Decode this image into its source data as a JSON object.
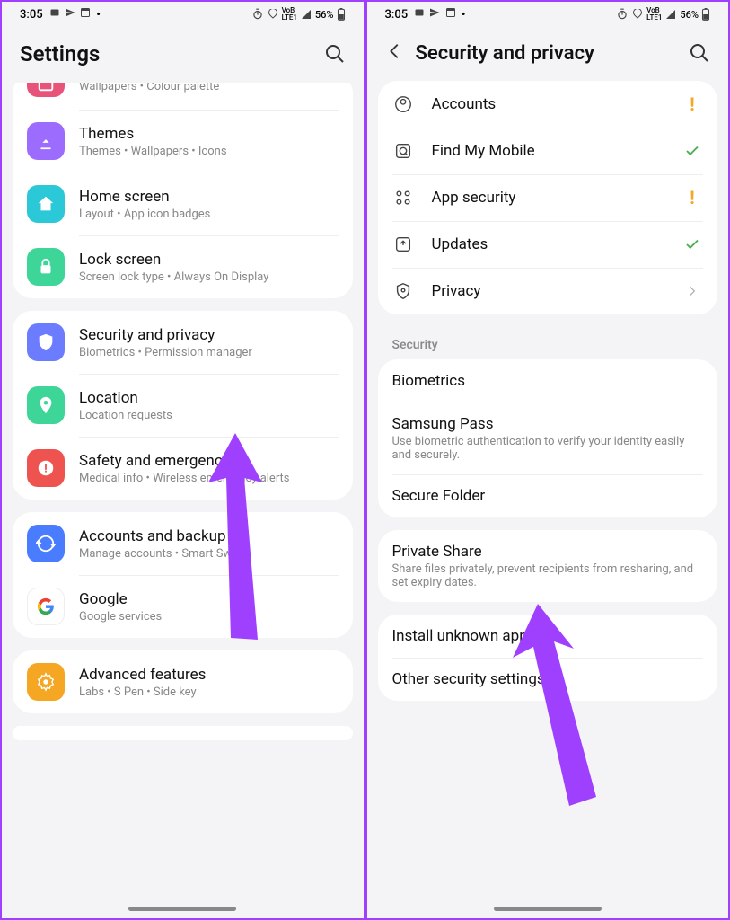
{
  "status": {
    "time": "3:05",
    "right_text": "56%"
  },
  "left": {
    "title": "Settings",
    "groups": [
      {
        "items": [
          {
            "title_hidden": true,
            "sub": "Wallpapers  •  Colour palette",
            "icon": "wallpaper",
            "bg": "#e8537a"
          },
          {
            "title": "Themes",
            "sub": "Themes  •  Wallpapers  •  Icons",
            "icon": "themes",
            "bg": "#9c6cff"
          },
          {
            "title": "Home screen",
            "sub": "Layout  •  App icon badges",
            "icon": "home",
            "bg": "#2bc8d8"
          },
          {
            "title": "Lock screen",
            "sub": "Screen lock type  •  Always On Display",
            "icon": "lock",
            "bg": "#3dd598"
          }
        ]
      },
      {
        "items": [
          {
            "title": "Security and privacy",
            "sub": "Biometrics  •  Permission manager",
            "icon": "shield",
            "bg": "#6c7cff"
          },
          {
            "title": "Location",
            "sub": "Location requests",
            "icon": "pin",
            "bg": "#3dd598"
          },
          {
            "title": "Safety and emergency",
            "sub": "Medical info  •  Wireless emergency alerts",
            "icon": "emergency",
            "bg": "#ef5350"
          }
        ]
      },
      {
        "items": [
          {
            "title": "Accounts and backup",
            "sub": "Manage accounts  •  Smart Switch",
            "icon": "sync",
            "bg": "#4a7cff"
          },
          {
            "title": "Google",
            "sub": "Google services",
            "icon": "google",
            "bg": "#fff"
          }
        ]
      },
      {
        "items": [
          {
            "title": "Advanced features",
            "sub": "Labs  •  S Pen  •  Side key",
            "icon": "gear",
            "bg": "#f5a623"
          }
        ]
      }
    ]
  },
  "right": {
    "title": "Security and privacy",
    "top_items": [
      {
        "title": "Accounts",
        "icon": "accounts",
        "status": "warn"
      },
      {
        "title": "Find My Mobile",
        "icon": "findmy",
        "status": "ok"
      },
      {
        "title": "App security",
        "icon": "appsec",
        "status": "warn"
      },
      {
        "title": "Updates",
        "icon": "updates",
        "status": "ok"
      },
      {
        "title": "Privacy",
        "icon": "privacy",
        "status": "arrow"
      }
    ],
    "section_label": "Security",
    "sec_group1": [
      {
        "title": "Biometrics"
      },
      {
        "title": "Samsung Pass",
        "sub": "Use biometric authentication to verify your identity easily and securely."
      },
      {
        "title": "Secure Folder"
      }
    ],
    "sec_group2": [
      {
        "title": "Private Share",
        "sub": "Share files privately, prevent recipients from resharing, and set expiry dates."
      }
    ],
    "sec_group3": [
      {
        "title": "Install unknown apps"
      },
      {
        "title": "Other security settings"
      }
    ]
  }
}
